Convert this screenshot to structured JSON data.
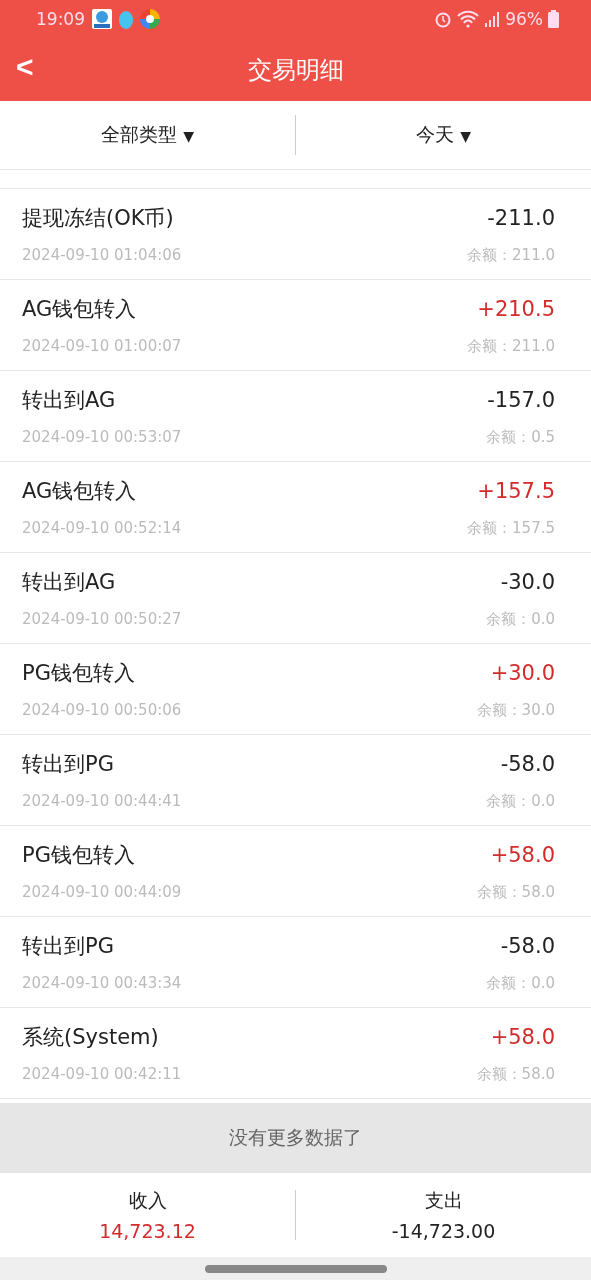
{
  "status_bar": {
    "time": "19:09",
    "battery": "96%"
  },
  "header": {
    "back": "<",
    "title": "交易明细"
  },
  "filters": [
    {
      "label": "全部类型",
      "arrow": "▼"
    },
    {
      "label": "今天",
      "arrow": "▼"
    }
  ],
  "transactions": [
    {
      "title": "提现冻结(OK币)",
      "time": "2024-09-10 01:04:06",
      "amount": "-211.0",
      "balance": "余额：211.0",
      "kind": "expense"
    },
    {
      "title": "AG钱包转入",
      "time": "2024-09-10 01:00:07",
      "amount": "+210.5",
      "balance": "余额：211.0",
      "kind": "income"
    },
    {
      "title": "转出到AG",
      "time": "2024-09-10 00:53:07",
      "amount": "-157.0",
      "balance": "余额：0.5",
      "kind": "expense"
    },
    {
      "title": "AG钱包转入",
      "time": "2024-09-10 00:52:14",
      "amount": "+157.5",
      "balance": "余额：157.5",
      "kind": "income"
    },
    {
      "title": "转出到AG",
      "time": "2024-09-10 00:50:27",
      "amount": "-30.0",
      "balance": "余额：0.0",
      "kind": "expense"
    },
    {
      "title": "PG钱包转入",
      "time": "2024-09-10 00:50:06",
      "amount": "+30.0",
      "balance": "余额：30.0",
      "kind": "income"
    },
    {
      "title": "转出到PG",
      "time": "2024-09-10 00:44:41",
      "amount": "-58.0",
      "balance": "余额：0.0",
      "kind": "expense"
    },
    {
      "title": "PG钱包转入",
      "time": "2024-09-10 00:44:09",
      "amount": "+58.0",
      "balance": "余额：58.0",
      "kind": "income"
    },
    {
      "title": "转出到PG",
      "time": "2024-09-10 00:43:34",
      "amount": "-58.0",
      "balance": "余额：0.0",
      "kind": "expense"
    },
    {
      "title": "系统(System)",
      "time": "2024-09-10 00:42:11",
      "amount": "+58.0",
      "balance": "余额：58.0",
      "kind": "income"
    }
  ],
  "no_more": "没有更多数据了",
  "summary": [
    {
      "label": "收入",
      "value": "14,723.12",
      "kind": "income"
    },
    {
      "label": "支出",
      "value": "-14,723.00",
      "kind": "expense"
    }
  ]
}
